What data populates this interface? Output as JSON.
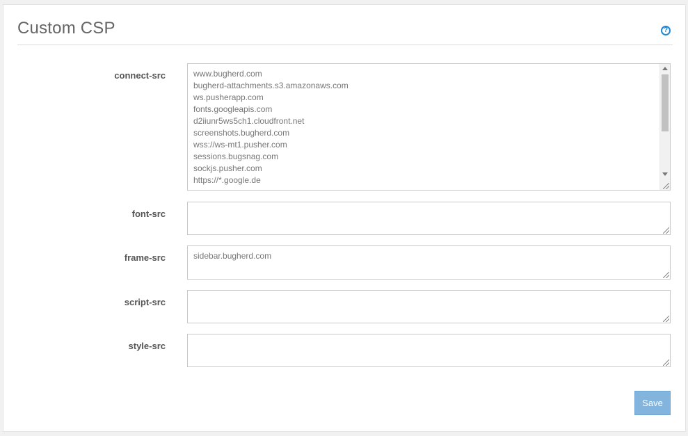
{
  "header": {
    "title": "Custom CSP",
    "help_icon": "question-circle-icon"
  },
  "fields": {
    "connect_src": {
      "label": "connect-src",
      "lines": [
        "www.bugherd.com",
        "bugherd-attachments.s3.amazonaws.com",
        "ws.pusherapp.com",
        "fonts.googleapis.com",
        "d2iiunr5ws5ch1.cloudfront.net",
        "screenshots.bugherd.com",
        "wss://ws-mt1.pusher.com",
        "sessions.bugsnag.com",
        "sockjs.pusher.com",
        "https://*.google.de"
      ]
    },
    "font_src": {
      "label": "font-src",
      "value": ""
    },
    "frame_src": {
      "label": "frame-src",
      "value": "sidebar.bugherd.com"
    },
    "script_src": {
      "label": "script-src",
      "value": ""
    },
    "style_src": {
      "label": "style-src",
      "value": ""
    }
  },
  "actions": {
    "save_label": "Save"
  },
  "colors": {
    "accent": "#1e88d6",
    "save_button": "#82b4de"
  }
}
